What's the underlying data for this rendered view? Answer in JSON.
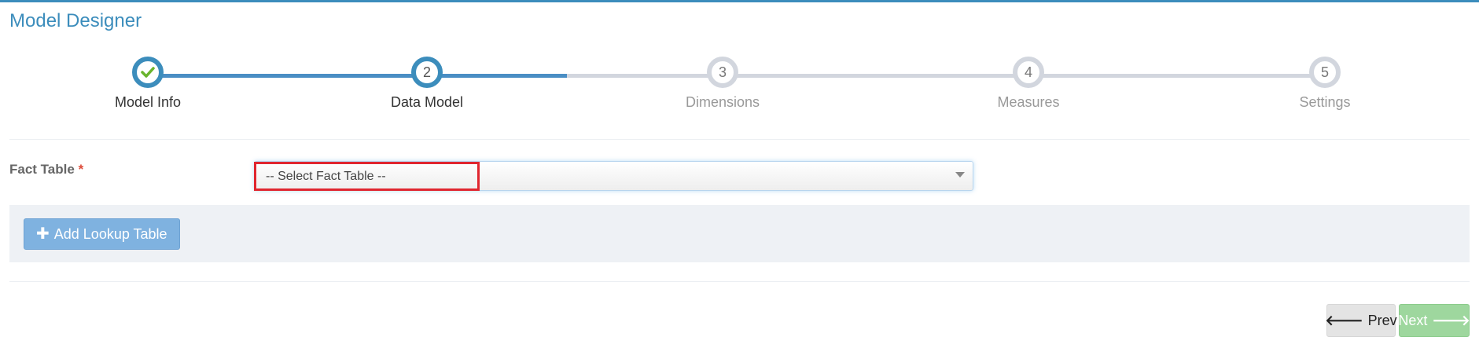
{
  "page": {
    "title": "Model Designer"
  },
  "wizard": {
    "steps": [
      {
        "number": "",
        "label": "Model Info",
        "state": "complete",
        "icon": "check-icon"
      },
      {
        "number": "2",
        "label": "Data Model",
        "state": "active"
      },
      {
        "number": "3",
        "label": "Dimensions",
        "state": "pending"
      },
      {
        "number": "4",
        "label": "Measures",
        "state": "pending"
      },
      {
        "number": "5",
        "label": "Settings",
        "state": "pending"
      }
    ]
  },
  "fact_table": {
    "label": "Fact Table",
    "required_marker": "*",
    "selected": "-- Select Fact Table --"
  },
  "lookup": {
    "add_label": "Add Lookup Table",
    "icon": "plus-icon"
  },
  "footer": {
    "prev_label": "Prev",
    "next_label": "Next",
    "prev_icon": "arrow-left-icon",
    "next_icon": "arrow-right-icon"
  },
  "colors": {
    "accent": "#3c8dbc",
    "check": "#6ab42d",
    "highlight": "#e0262f",
    "next": "#9ed79e"
  }
}
